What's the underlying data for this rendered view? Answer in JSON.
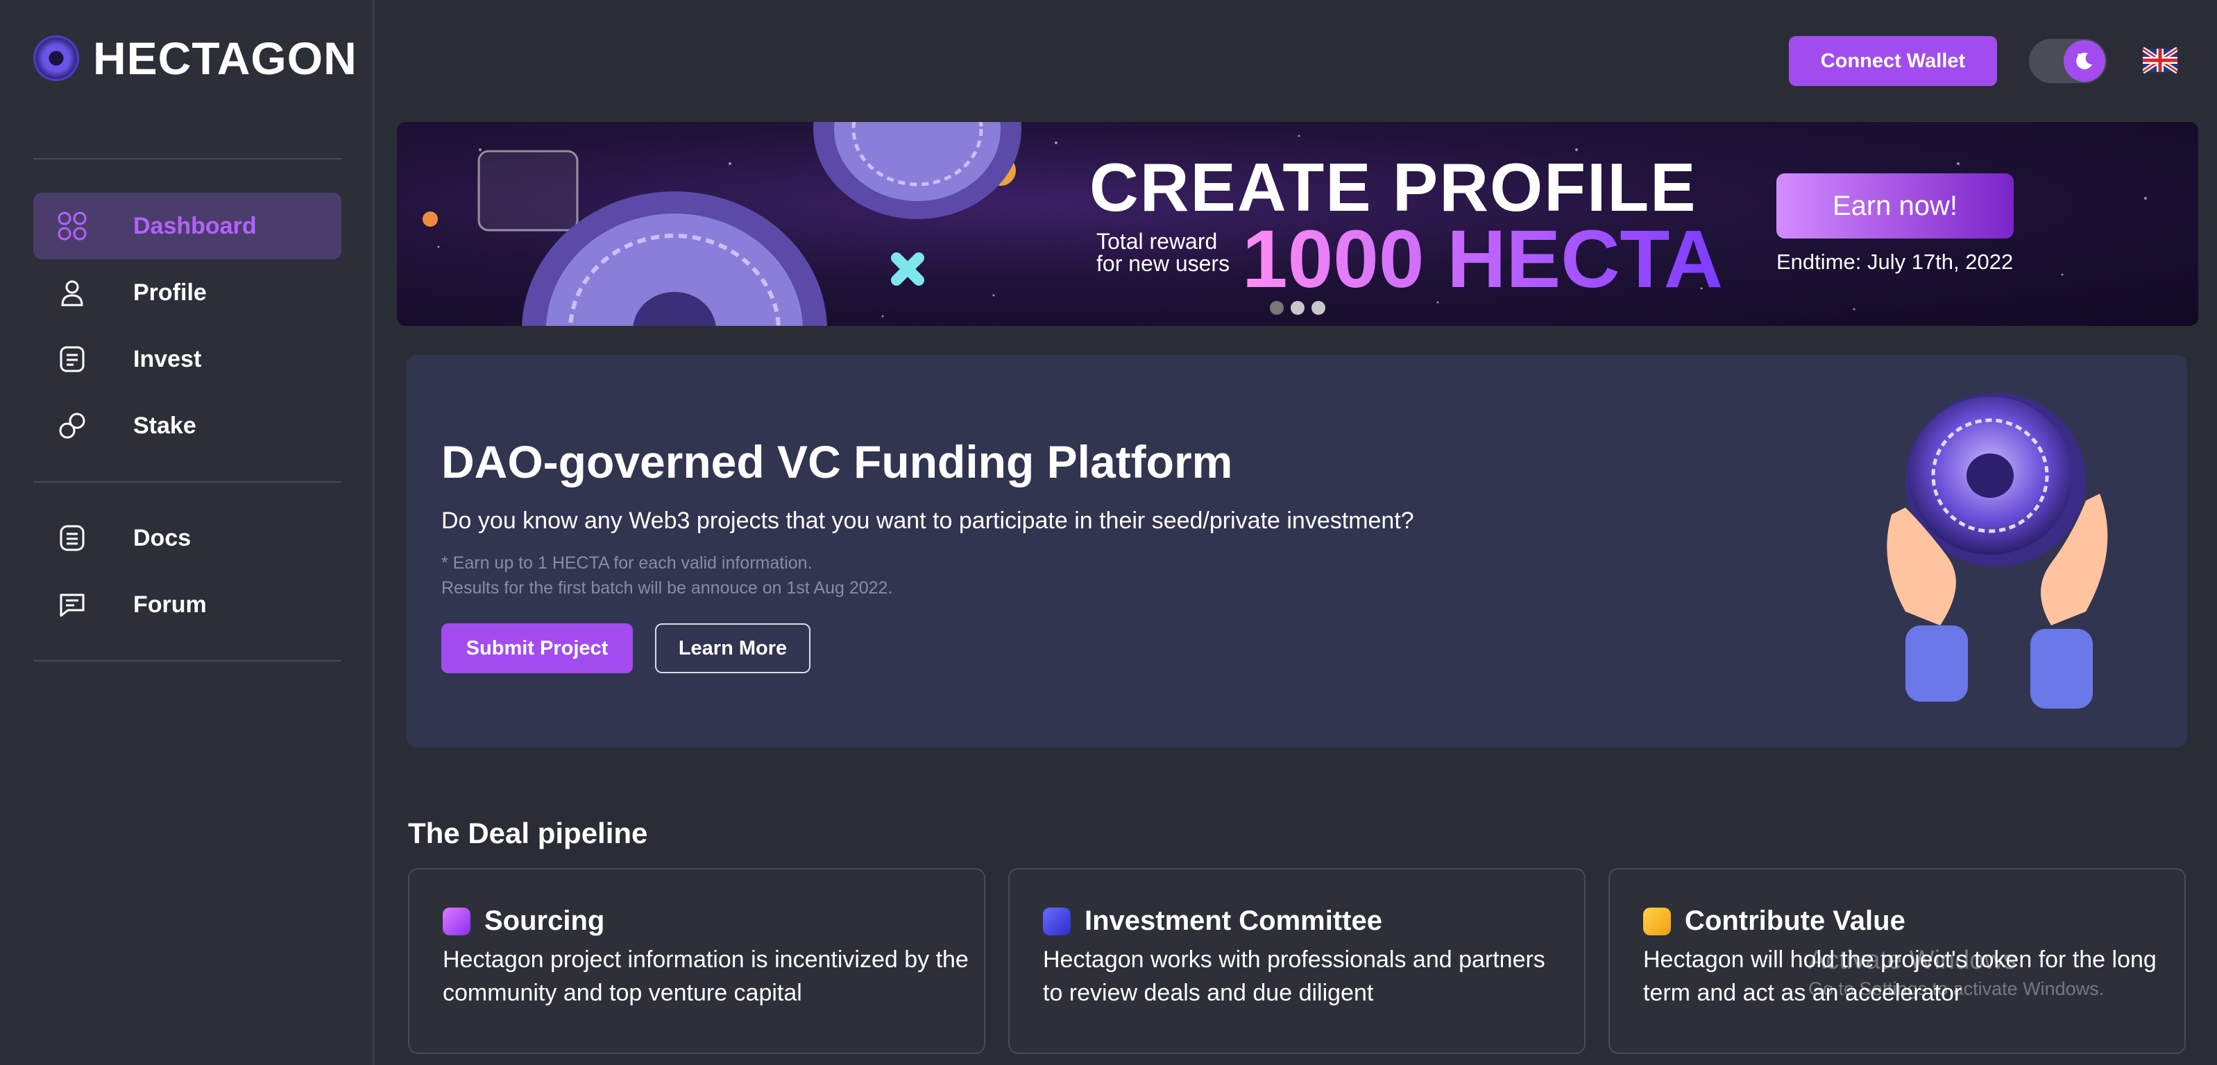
{
  "brand": {
    "name": "HECTAGON"
  },
  "sidebar": {
    "items": [
      {
        "label": "Dashboard",
        "icon": "dashboard-grid-icon",
        "active": true
      },
      {
        "label": "Profile",
        "icon": "user-icon"
      },
      {
        "label": "Invest",
        "icon": "invest-document-icon"
      },
      {
        "label": "Stake",
        "icon": "stake-link-icon"
      },
      {
        "label": "Docs",
        "icon": "docs-icon"
      },
      {
        "label": "Forum",
        "icon": "forum-chat-icon"
      }
    ]
  },
  "topbar": {
    "connect_label": "Connect Wallet",
    "theme_toggle_icon": "moon-icon",
    "language_icon": "uk-flag-icon"
  },
  "banner": {
    "title": "CREATE PROFILE",
    "subtitle": "Total reward for new users",
    "amount": "1000 HECTA",
    "cta": "Earn now!",
    "endtime": "Endtime: July 17th, 2022",
    "slides": 3,
    "active_slide": 2
  },
  "hero": {
    "title": "DAO-governed VC Funding Platform",
    "question": "Do you know any Web3 projects that you want to participate in their seed/private investment?",
    "note1": "* Earn up to 1 HECTA for each valid information.",
    "note2": "Results for the first batch will be annouce on 1st Aug 2022.",
    "submit_label": "Submit Project",
    "learn_label": "Learn More"
  },
  "pipeline": {
    "title": "The Deal pipeline",
    "cards": [
      {
        "title": "Sourcing",
        "text": "Hectagon project information is incentivized by the community and top venture capital",
        "color": "#c04cf0"
      },
      {
        "title": "Investment Committee",
        "text": "Hectagon works with professionals and partners to review deals and due diligent",
        "color": "#4a4cf0"
      },
      {
        "title": "Contribute Value",
        "text": "Hectagon will hold the project's token for the long term and act as an accelerator",
        "color": "#f0b020"
      }
    ]
  },
  "watermark": {
    "line1": "Activate Windows",
    "line2": "Go to Settings to activate Windows."
  },
  "colors": {
    "accent": "#a24cf0",
    "background": "#2b2d36",
    "card": "#323550"
  }
}
